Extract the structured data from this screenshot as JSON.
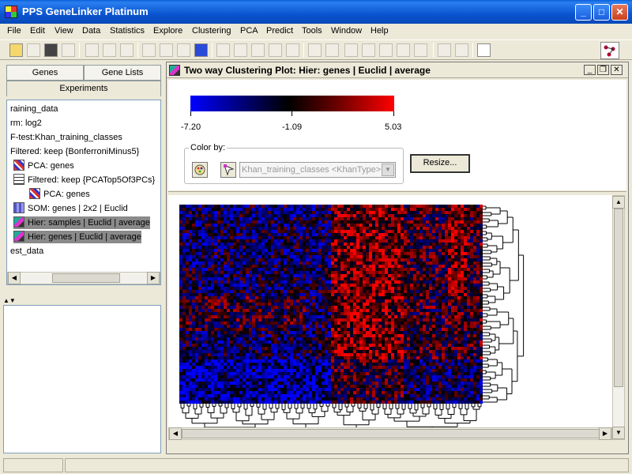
{
  "window": {
    "title": "PPS GeneLinker Platinum",
    "min": "_",
    "max": "□",
    "close": "✕"
  },
  "menu": [
    "File",
    "Edit",
    "View",
    "Data",
    "Statistics",
    "Explore",
    "Clustering",
    "PCA",
    "Predict",
    "Tools",
    "Window",
    "Help"
  ],
  "left_panel": {
    "tabs": [
      "Genes",
      "Gene Lists",
      "Experiments"
    ],
    "tree": [
      {
        "label": "raining_data",
        "icon": "none"
      },
      {
        "label": "rm: log2",
        "icon": "none"
      },
      {
        "label": "F-test:Khan_training_classes",
        "icon": "none"
      },
      {
        "label": "Filtered: keep {BonferroniMinus5}",
        "icon": "none"
      },
      {
        "label": "PCA: genes",
        "icon": "pca-icon"
      },
      {
        "label": "Filtered: keep {PCATop5Of3PCs}",
        "icon": "grid-icon"
      },
      {
        "label": "PCA: genes",
        "icon": "pca-icon"
      },
      {
        "label": "SOM: genes  | 2x2 | Euclid",
        "icon": "som-icon"
      },
      {
        "label": "Hier: samples  | Euclid | average",
        "icon": "hier-icon",
        "selected": true
      },
      {
        "label": "Hier: genes  | Euclid | average",
        "icon": "hier-icon",
        "selected": true
      },
      {
        "label": "est_data",
        "icon": "none"
      }
    ]
  },
  "plot_window": {
    "title": "Two way Clustering Plot: Hier: genes   | Euclid  | average",
    "colorbar": {
      "min_label": "-7.20",
      "mid_label": "-1.09",
      "max_label": "5.03",
      "colors": [
        "#0000ff",
        "#000000",
        "#ff0000"
      ]
    },
    "color_by": {
      "label": "Color by:",
      "selected": "Khan_training_classes <KhanType>"
    },
    "resize_label": "Resize..."
  },
  "accent": "#0a5fd8"
}
